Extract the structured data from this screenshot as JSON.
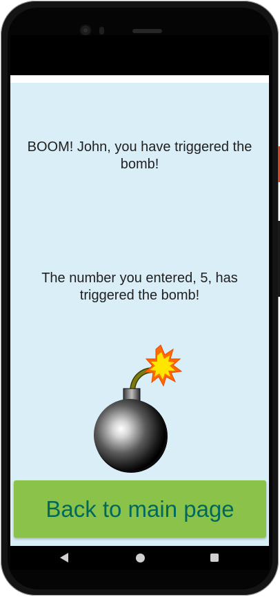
{
  "result_screen": {
    "message_trigger": "BOOM! John, you have triggered the bomb!",
    "message_number": "The number you entered, 5, has triggered the bomb!",
    "back_button_label": "Back to main page"
  },
  "colors": {
    "content_background": "#daeef8",
    "button_background": "#8bc34a",
    "button_text": "#00695c"
  },
  "icons": {
    "bomb": "bomb-icon",
    "back": "back-icon",
    "home": "home-icon",
    "recents": "recents-icon"
  }
}
